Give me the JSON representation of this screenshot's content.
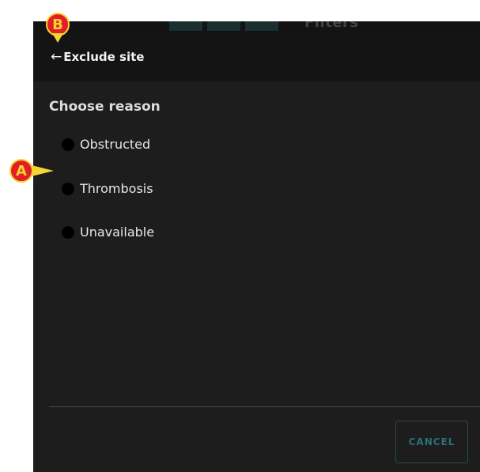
{
  "background": {
    "filters_label": "Filters"
  },
  "header": {
    "back_icon": "←",
    "title": "Exclude site"
  },
  "section": {
    "title": "Choose reason"
  },
  "options": [
    {
      "label": "Obstructed",
      "selected": false
    },
    {
      "label": "Thrombosis",
      "selected": false
    },
    {
      "label": "Unavailable",
      "selected": false
    }
  ],
  "footer": {
    "cancel_label": "CANCEL"
  },
  "annotations": {
    "marker_a": "A",
    "marker_b": "B",
    "marker_fill": "#e21f26",
    "marker_outline": "#f6d531"
  },
  "colors": {
    "panel_bg": "#1d1d1d",
    "header_bg": "#141414",
    "accent": "#2f6e7a"
  }
}
